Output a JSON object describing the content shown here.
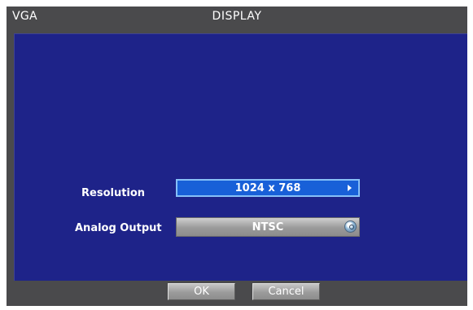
{
  "window": {
    "left_title": "VGA",
    "center_title": "DISPLAY"
  },
  "settings": {
    "resolution": {
      "label": "Resolution",
      "value": "1024 x 768",
      "icon": "arrow-right-icon"
    },
    "analog_output": {
      "label": "Analog Output",
      "value": "NTSC",
      "icon": "cycle-icon"
    }
  },
  "buttons": {
    "ok": "OK",
    "cancel": "Cancel"
  },
  "colors": {
    "panel_blue": "#1e2389",
    "frame_gray": "#4a4a4c",
    "selected_field": "#1860d8"
  }
}
